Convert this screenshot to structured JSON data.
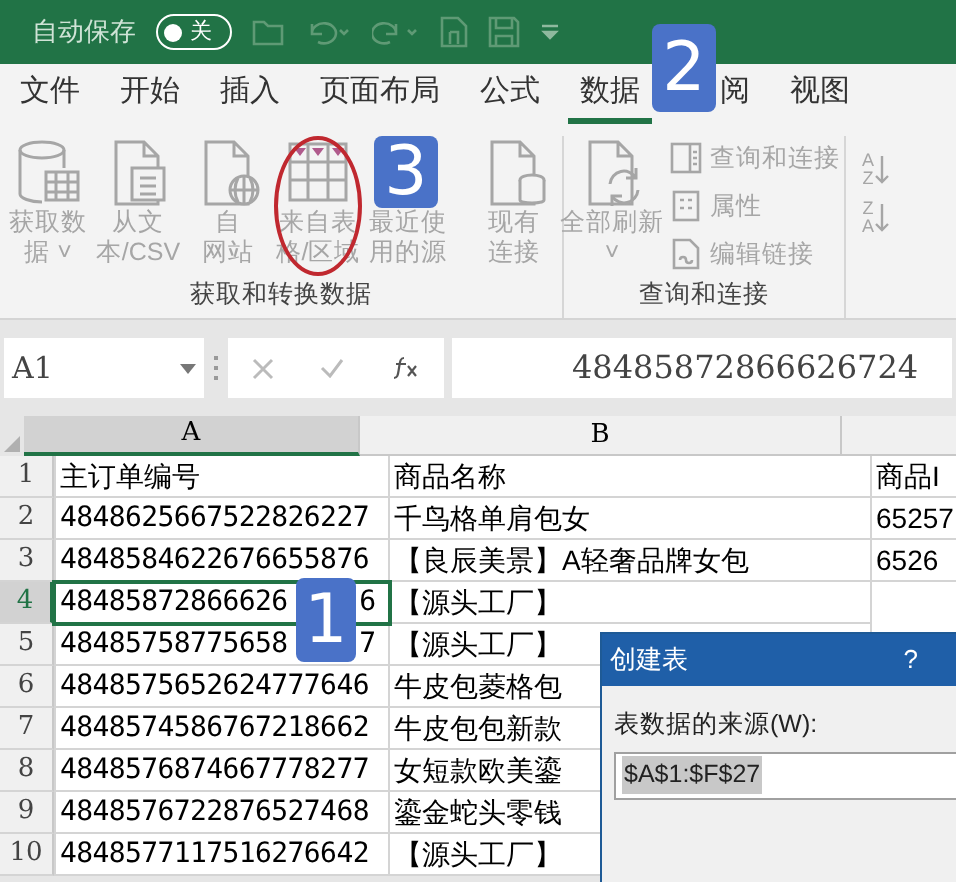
{
  "title_bar": {
    "autosave_label": "自动保存",
    "autosave_toggle": {
      "label": "关",
      "on": false
    }
  },
  "tabs": [
    {
      "label": "文件",
      "selected": false
    },
    {
      "label": "开始",
      "selected": false
    },
    {
      "label": "插入",
      "selected": false
    },
    {
      "label": "页面布局",
      "selected": false
    },
    {
      "label": "公式",
      "selected": false
    },
    {
      "label": "数据",
      "selected": true
    },
    {
      "label": "阅",
      "selected": false
    },
    {
      "label": "视图",
      "selected": false
    }
  ],
  "ribbon": {
    "groups": [
      {
        "label": "获取和转换数据",
        "buttons": [
          {
            "kind": "database",
            "lines": [
              "获取数",
              "据 ˅"
            ],
            "highlighted": false
          },
          {
            "kind": "text-file",
            "lines": [
              "从文",
              "本/CSV"
            ],
            "highlighted": false
          },
          {
            "kind": "web",
            "lines": [
              "自",
              "网站"
            ],
            "highlighted": false
          },
          {
            "kind": "table",
            "lines": [
              "来自表",
              "格/区域"
            ],
            "highlighted": true
          },
          {
            "kind": "badge",
            "lines": [
              "最近使",
              "用的源"
            ],
            "highlighted": false
          },
          {
            "kind": "connection",
            "lines": [
              "现有",
              "连接"
            ],
            "highlighted": false
          }
        ]
      },
      {
        "label": "查询和连接",
        "buttons": [
          {
            "kind": "refresh",
            "lines": [
              "全部刷新",
              "˅"
            ],
            "highlighted": false
          }
        ],
        "small_buttons": [
          {
            "kind": "queries",
            "label": "查询和连接"
          },
          {
            "kind": "properties",
            "label": "属性"
          },
          {
            "kind": "links",
            "label": "编辑链接"
          }
        ]
      }
    ],
    "sort": [
      {
        "top": "A",
        "bottom": "Z"
      },
      {
        "top": "Z",
        "bottom": "A"
      }
    ]
  },
  "formula_bar": {
    "name_box": "A1",
    "value": "48485872866626724"
  },
  "sheet": {
    "columns": [
      {
        "label": "A",
        "selected": true
      },
      {
        "label": "B",
        "selected": false
      },
      {
        "selected": false
      }
    ],
    "rows": [
      {
        "number": "1",
        "selected": false,
        "cells": [
          {
            "text": "主订单编号"
          },
          {
            "text": "商品名称"
          },
          {
            "text": "商品I"
          }
        ]
      },
      {
        "number": "2",
        "selected": false,
        "cells": [
          {
            "text": "4848625667522826227"
          },
          {
            "text": "千鸟格单肩包女"
          },
          {
            "text": "65257"
          }
        ]
      },
      {
        "number": "3",
        "selected": false,
        "cells": [
          {
            "text": "4848584622676655876"
          },
          {
            "text": "【良辰美景】A轻奢品牌女包"
          },
          {
            "text": "6526"
          }
        ]
      },
      {
        "number": "4",
        "selected": true,
        "cells": [
          {
            "text": "48485872866626",
            "tail": "6"
          },
          {
            "text": "【源头工厂】"
          }
        ]
      },
      {
        "number": "5",
        "selected": false,
        "cells": [
          {
            "text": "48485758775658",
            "tail": "7"
          },
          {
            "text": "【源头工厂】"
          }
        ]
      },
      {
        "number": "6",
        "selected": false,
        "cells": [
          {
            "text": "4848575652624777646"
          },
          {
            "text": "牛皮包菱格包"
          }
        ]
      },
      {
        "number": "7",
        "selected": false,
        "cells": [
          {
            "text": "4848574586767218662"
          },
          {
            "text": "牛皮包包新款"
          }
        ]
      },
      {
        "number": "8",
        "selected": false,
        "cells": [
          {
            "text": "4848576874667778277"
          },
          {
            "text": "女短款欧美鎏"
          }
        ]
      },
      {
        "number": "9",
        "selected": false,
        "cells": [
          {
            "text": "4848576722876527468"
          },
          {
            "text": "鎏金蛇头零钱"
          }
        ]
      },
      {
        "number": "10",
        "selected": false,
        "cells": [
          {
            "text": "4848577117516276642"
          },
          {
            "text": "【源头工厂】"
          }
        ]
      }
    ]
  },
  "dialog": {
    "title": "创建表",
    "help": "?",
    "prompt": "表数据的来源(W):",
    "range": "$A$1:$F$27"
  },
  "step_badges": [
    "1",
    "2",
    "3"
  ]
}
